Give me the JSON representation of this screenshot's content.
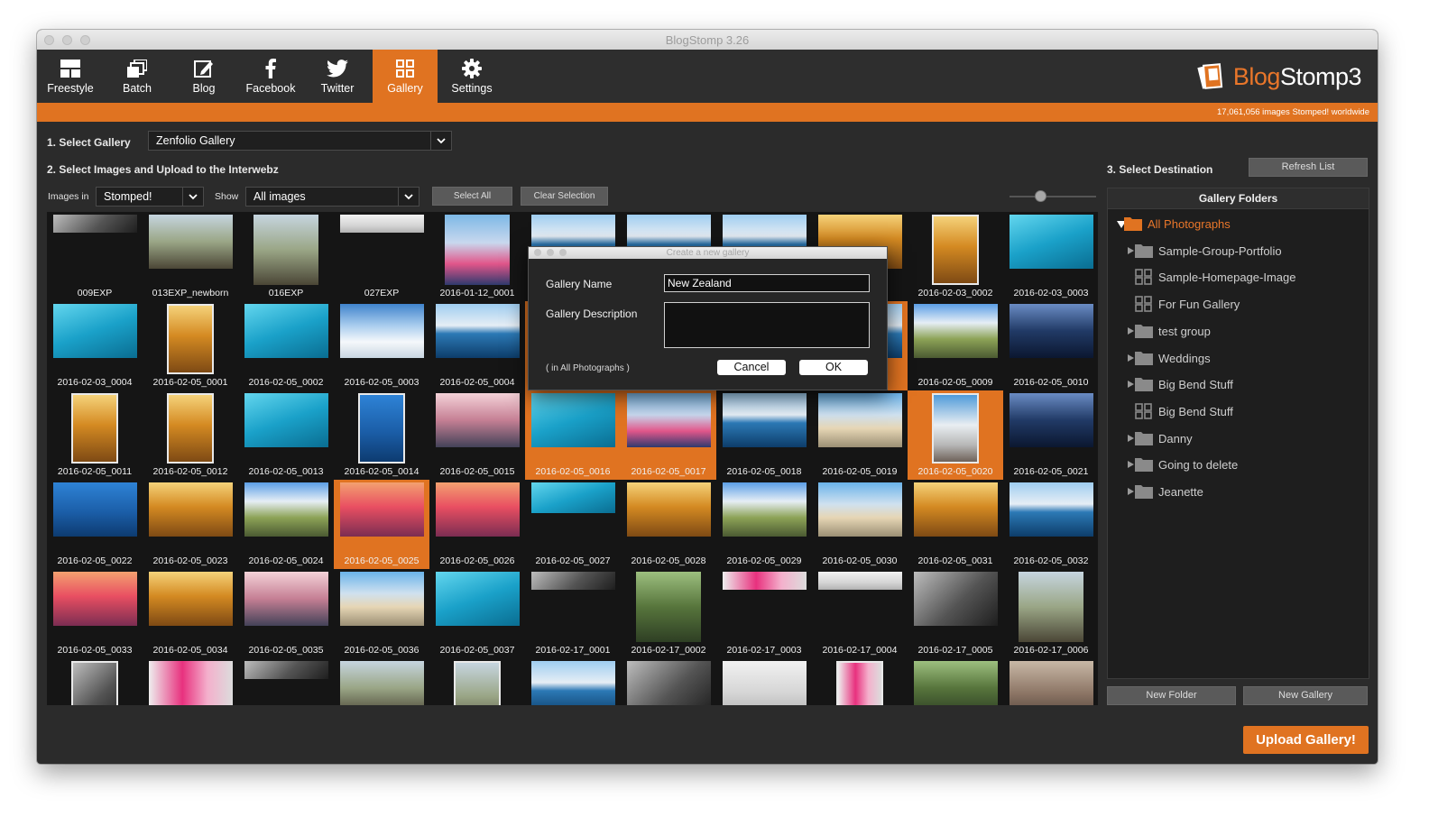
{
  "window": {
    "title": "BlogStomp 3.26"
  },
  "toolbar": {
    "items": [
      {
        "label": "Freestyle",
        "icon": "freestyle-icon",
        "active": false
      },
      {
        "label": "Batch",
        "icon": "batch-icon",
        "active": false
      },
      {
        "label": "Blog",
        "icon": "blog-edit-icon",
        "active": false
      },
      {
        "label": "Facebook",
        "icon": "facebook-icon",
        "active": false
      },
      {
        "label": "Twitter",
        "icon": "twitter-icon",
        "active": false
      },
      {
        "label": "Gallery",
        "icon": "gallery-grid-icon",
        "active": true
      },
      {
        "label": "Settings",
        "icon": "gear-icon",
        "active": false
      }
    ],
    "logo": {
      "part1": "Blog",
      "part2": "Stomp3"
    }
  },
  "status": {
    "stomped_count": "17,061,056 images Stomped! worldwide"
  },
  "step1": {
    "label": "1. Select Gallery",
    "gallery_value": "Zenfolio Gallery"
  },
  "step2": {
    "label": "2. Select Images and Upload to the Interwebz",
    "images_in_label": "Images in",
    "images_in_value": "Stomped!",
    "show_label": "Show",
    "show_value": "All images",
    "select_all": "Select All",
    "clear_selection": "Clear Selection",
    "thumb_size": 0.35
  },
  "step3": {
    "label": "3. Select Destination",
    "refresh": "Refresh List",
    "panel_title": "Gallery Folders",
    "folders": [
      {
        "label": "All Photographs",
        "type": "folder",
        "expanded": true,
        "indent": 0,
        "highlight": true
      },
      {
        "label": "Sample-Group-Portfolio",
        "type": "folder",
        "expanded": false,
        "indent": 1,
        "highlight": false
      },
      {
        "label": "Sample-Homepage-Image",
        "type": "gallery",
        "indent": 1,
        "highlight": false
      },
      {
        "label": "For Fun Gallery",
        "type": "gallery",
        "indent": 1,
        "highlight": false
      },
      {
        "label": "test group",
        "type": "folder",
        "expanded": false,
        "indent": 1,
        "highlight": false
      },
      {
        "label": "Weddings",
        "type": "folder",
        "expanded": false,
        "indent": 1,
        "highlight": false
      },
      {
        "label": "Big Bend Stuff",
        "type": "folder",
        "expanded": false,
        "indent": 1,
        "highlight": false
      },
      {
        "label": "Big Bend Stuff",
        "type": "gallery",
        "indent": 1,
        "highlight": false
      },
      {
        "label": "Danny",
        "type": "folder",
        "expanded": false,
        "indent": 1,
        "highlight": false
      },
      {
        "label": "Going to delete",
        "type": "folder",
        "expanded": false,
        "indent": 1,
        "highlight": false
      },
      {
        "label": "Jeanette",
        "type": "folder",
        "expanded": false,
        "indent": 1,
        "highlight": false
      }
    ],
    "new_folder": "New Folder",
    "new_gallery": "New Gallery",
    "upload": "Upload Gallery!"
  },
  "dialog": {
    "title": "Create a new gallery",
    "name_label": "Gallery Name",
    "name_value": "New Zealand",
    "desc_label": "Gallery Description",
    "desc_value": "",
    "location_note": "( in All Photographs )",
    "cancel": "Cancel",
    "ok": "OK"
  },
  "images": [
    {
      "name": "009EXP",
      "theme": "bw",
      "shape": "strip",
      "sel": false
    },
    {
      "name": "013EXP_newborn",
      "theme": "couple",
      "shape": "land",
      "sel": false
    },
    {
      "name": "016EXP",
      "theme": "couple",
      "shape": "collage",
      "sel": false
    },
    {
      "name": "027EXP",
      "theme": "light",
      "shape": "strip",
      "sel": false
    },
    {
      "name": "2016-01-12_0001",
      "theme": "bridge",
      "shape": "collage",
      "sel": false
    },
    {
      "name": "",
      "theme": "lake",
      "shape": "land",
      "sel": false
    },
    {
      "name": "",
      "theme": "lake",
      "shape": "land",
      "sel": false
    },
    {
      "name": "",
      "theme": "lake",
      "shape": "land",
      "sel": false
    },
    {
      "name": "",
      "theme": "autumn",
      "shape": "land",
      "sel": false
    },
    {
      "name": "2016-02-03_0002",
      "theme": "autumn",
      "shape": "port",
      "sel": false
    },
    {
      "name": "2016-02-03_0003",
      "theme": "teal",
      "shape": "land",
      "sel": false
    },
    {
      "name": "2016-02-03_0004",
      "theme": "teal",
      "shape": "land",
      "sel": false
    },
    {
      "name": "2016-02-05_0001",
      "theme": "autumn",
      "shape": "port",
      "sel": false
    },
    {
      "name": "2016-02-05_0002",
      "theme": "teal",
      "shape": "land",
      "sel": false
    },
    {
      "name": "2016-02-05_0003",
      "theme": "snow",
      "shape": "land",
      "sel": false
    },
    {
      "name": "2016-02-05_0004",
      "theme": "lake",
      "shape": "land",
      "sel": false
    },
    {
      "name": "",
      "theme": "lake",
      "shape": "land",
      "sel": true
    },
    {
      "name": "",
      "theme": "lake",
      "shape": "land",
      "sel": false
    },
    {
      "name": "",
      "theme": "lake",
      "shape": "land",
      "sel": false
    },
    {
      "name": "",
      "theme": "lake",
      "shape": "land",
      "sel": true
    },
    {
      "name": "2016-02-05_0009",
      "theme": "mountain",
      "shape": "land",
      "sel": false
    },
    {
      "name": "2016-02-05_0010",
      "theme": "dusk",
      "shape": "land",
      "sel": false
    },
    {
      "name": "2016-02-05_0011",
      "theme": "autumn",
      "shape": "port",
      "sel": false
    },
    {
      "name": "2016-02-05_0012",
      "theme": "autumn",
      "shape": "port",
      "sel": false
    },
    {
      "name": "2016-02-05_0013",
      "theme": "teal",
      "shape": "land",
      "sel": false
    },
    {
      "name": "2016-02-05_0014",
      "theme": "blue",
      "shape": "port",
      "sel": false
    },
    {
      "name": "2016-02-05_0015",
      "theme": "pink",
      "shape": "land",
      "sel": false
    },
    {
      "name": "2016-02-05_0016",
      "theme": "teal",
      "shape": "land",
      "sel": true
    },
    {
      "name": "2016-02-05_0017",
      "theme": "bridge",
      "shape": "land",
      "sel": true
    },
    {
      "name": "2016-02-05_0018",
      "theme": "lake",
      "shape": "land",
      "sel": false
    },
    {
      "name": "2016-02-05_0019",
      "theme": "beach",
      "shape": "land",
      "sel": false
    },
    {
      "name": "2016-02-05_0020",
      "theme": "geyser",
      "shape": "port",
      "sel": true
    },
    {
      "name": "2016-02-05_0021",
      "theme": "dusk",
      "shape": "land",
      "sel": false
    },
    {
      "name": "2016-02-05_0022",
      "theme": "blue",
      "shape": "land",
      "sel": false
    },
    {
      "name": "2016-02-05_0023",
      "theme": "autumn",
      "shape": "land",
      "sel": false
    },
    {
      "name": "2016-02-05_0024",
      "theme": "mountain",
      "shape": "land",
      "sel": false
    },
    {
      "name": "2016-02-05_0025",
      "theme": "sunset",
      "shape": "land",
      "sel": true
    },
    {
      "name": "2016-02-05_0026",
      "theme": "sunset",
      "shape": "land",
      "sel": false
    },
    {
      "name": "2016-02-05_0027",
      "theme": "teal",
      "shape": "wide",
      "sel": false
    },
    {
      "name": "2016-02-05_0028",
      "theme": "autumn",
      "shape": "land",
      "sel": false
    },
    {
      "name": "2016-02-05_0029",
      "theme": "mountain",
      "shape": "land",
      "sel": false
    },
    {
      "name": "2016-02-05_0030",
      "theme": "beach",
      "shape": "land",
      "sel": false
    },
    {
      "name": "2016-02-05_0031",
      "theme": "autumn",
      "shape": "land",
      "sel": false
    },
    {
      "name": "2016-02-05_0032",
      "theme": "lake",
      "shape": "land",
      "sel": false
    },
    {
      "name": "2016-02-05_0033",
      "theme": "sunset",
      "shape": "land",
      "sel": false
    },
    {
      "name": "2016-02-05_0034",
      "theme": "autumn",
      "shape": "land",
      "sel": false
    },
    {
      "name": "2016-02-05_0035",
      "theme": "pink",
      "shape": "land",
      "sel": false
    },
    {
      "name": "2016-02-05_0036",
      "theme": "beach",
      "shape": "land",
      "sel": false
    },
    {
      "name": "2016-02-05_0037",
      "theme": "teal",
      "shape": "land",
      "sel": false
    },
    {
      "name": "2016-02-17_0001",
      "theme": "bw",
      "shape": "strip",
      "sel": false
    },
    {
      "name": "2016-02-17_0002",
      "theme": "green",
      "shape": "collage",
      "sel": false
    },
    {
      "name": "2016-02-17_0003",
      "theme": "magenta",
      "shape": "strip",
      "sel": false
    },
    {
      "name": "2016-02-17_0004",
      "theme": "light",
      "shape": "strip",
      "sel": false
    },
    {
      "name": "2016-02-17_0005",
      "theme": "bw",
      "shape": "land",
      "sel": false
    },
    {
      "name": "2016-02-17_0006",
      "theme": "couple",
      "shape": "collage",
      "sel": false
    },
    {
      "name": "",
      "theme": "bw",
      "shape": "port",
      "sel": false
    },
    {
      "name": "",
      "theme": "magenta",
      "shape": "land",
      "sel": false
    },
    {
      "name": "",
      "theme": "bw",
      "shape": "strip",
      "sel": false
    },
    {
      "name": "",
      "theme": "couple",
      "shape": "land",
      "sel": false
    },
    {
      "name": "",
      "theme": "couple",
      "shape": "port",
      "sel": false
    },
    {
      "name": "",
      "theme": "lake",
      "shape": "land",
      "sel": false
    },
    {
      "name": "",
      "theme": "bw",
      "shape": "land",
      "sel": false
    },
    {
      "name": "",
      "theme": "light",
      "shape": "land",
      "sel": false
    },
    {
      "name": "",
      "theme": "magenta",
      "shape": "port",
      "sel": false
    },
    {
      "name": "",
      "theme": "green",
      "shape": "land",
      "sel": false
    },
    {
      "name": "",
      "theme": "baby",
      "shape": "land",
      "sel": false
    }
  ]
}
